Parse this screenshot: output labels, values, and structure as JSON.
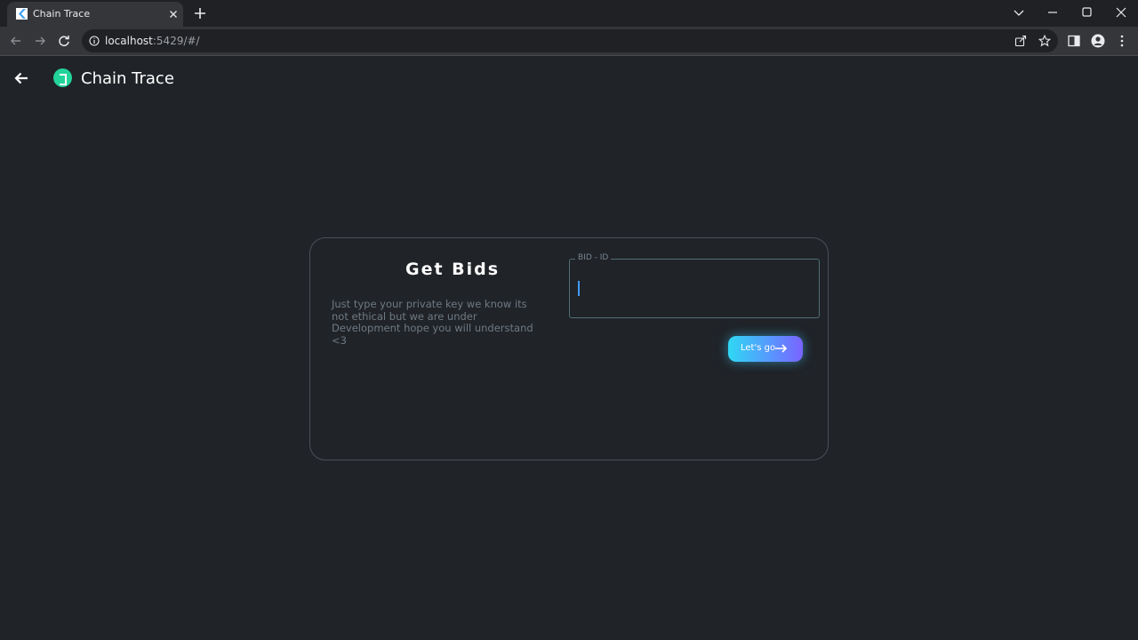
{
  "browser": {
    "tab_title": "Chain Trace",
    "url_host": "localhost",
    "url_rest": ":5429/#/"
  },
  "appbar": {
    "title": "Chain Trace"
  },
  "card": {
    "title": "Get Bids",
    "description": "Just type your private key we know its not ethical but we are under Development hope you will understand <3",
    "field_label": "BID - ID",
    "field_value": "",
    "button_label": "Let's go"
  },
  "colors": {
    "background": "#202328",
    "accent_gradient_start": "#2fd8f4",
    "accent_gradient_end": "#7a63ff",
    "logo": "#22d39a"
  }
}
